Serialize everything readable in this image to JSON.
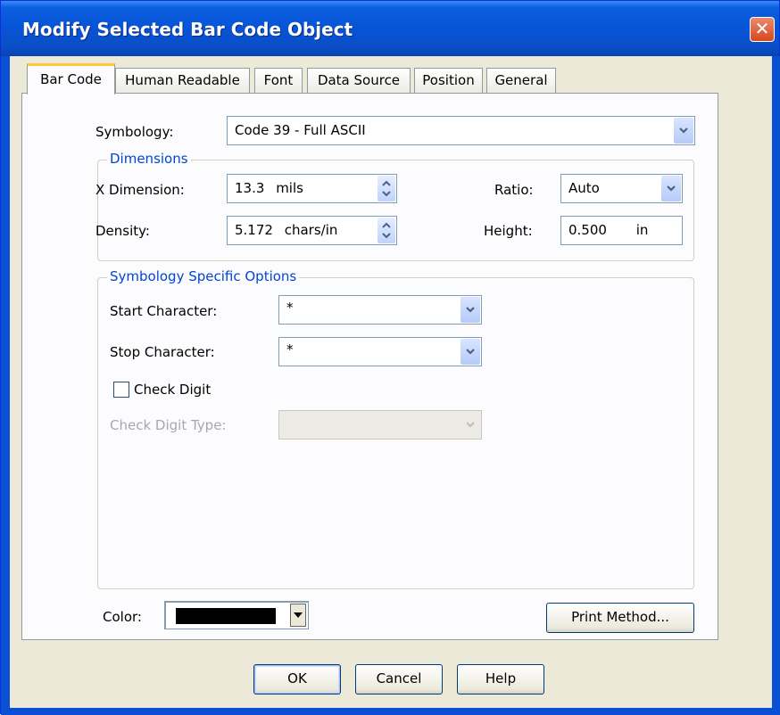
{
  "window": {
    "title": "Modify Selected Bar Code Object",
    "close_glyph": "✕"
  },
  "tabs": [
    {
      "label": "Bar Code",
      "active": true
    },
    {
      "label": "Human Readable",
      "active": false
    },
    {
      "label": "Font",
      "active": false
    },
    {
      "label": "Data Source",
      "active": false
    },
    {
      "label": "Position",
      "active": false
    },
    {
      "label": "General",
      "active": false
    }
  ],
  "symbology": {
    "label": "Symbology:",
    "value": "Code 39 - Full ASCII"
  },
  "dimensions": {
    "title": "Dimensions",
    "x_dimension": {
      "label": "X Dimension:",
      "value": "13.3",
      "unit": "mils"
    },
    "density": {
      "label": "Density:",
      "value": "5.172",
      "unit": "chars/in"
    },
    "ratio": {
      "label": "Ratio:",
      "value": "Auto"
    },
    "height": {
      "label": "Height:",
      "value": "0.500",
      "unit": "in"
    }
  },
  "options": {
    "title": "Symbology Specific Options",
    "start_character": {
      "label": "Start Character:",
      "value": "*"
    },
    "stop_character": {
      "label": "Stop Character:",
      "value": "*"
    },
    "check_digit": {
      "label": "Check Digit",
      "checked": false
    },
    "check_digit_type": {
      "label": "Check Digit Type:",
      "value": "",
      "disabled": true
    }
  },
  "color": {
    "label": "Color:",
    "value_hex": "#000000"
  },
  "buttons": {
    "print_method": "Print Method...",
    "ok": "OK",
    "cancel": "Cancel",
    "help": "Help"
  },
  "icons": {
    "dropdown": "chevron-down-icon",
    "spinner": "spinner-icon",
    "close": "close-icon"
  }
}
